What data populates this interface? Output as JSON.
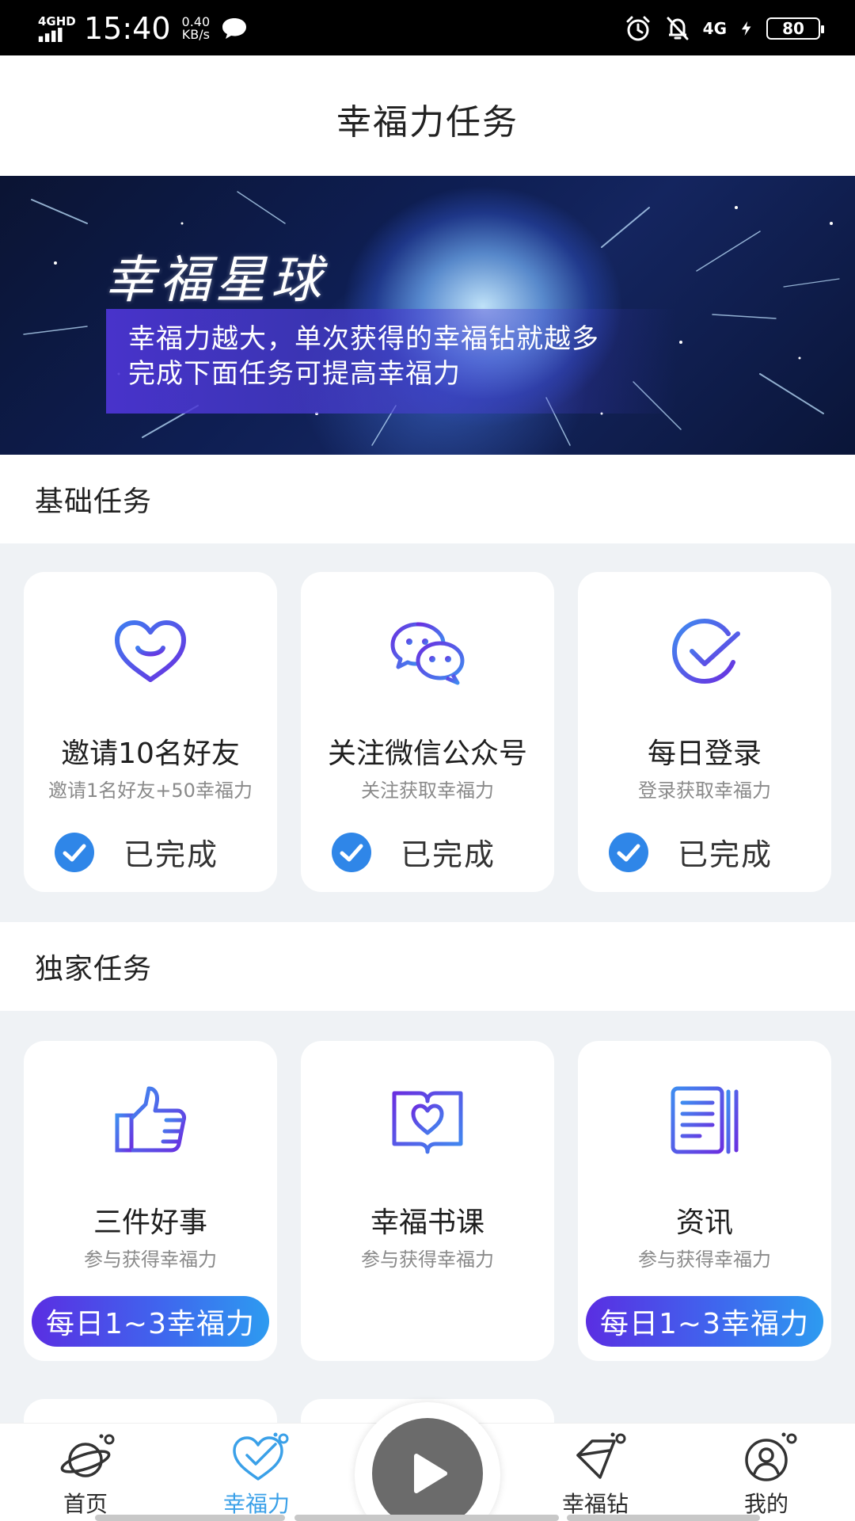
{
  "status_bar": {
    "network_label": "4GHD",
    "time": "15:40",
    "speed_value": "0.40",
    "speed_unit": "KB/s",
    "net_4g": "4G",
    "battery": "80"
  },
  "header": {
    "title": "幸福力任务"
  },
  "banner": {
    "title": "幸福星球",
    "line1": "幸福力越大，单次获得的幸福钻就越多",
    "line2": "完成下面任务可提高幸福力"
  },
  "basic": {
    "title": "基础任务",
    "cards": [
      {
        "icon": "heart-smile-icon",
        "title": "邀请10名好友",
        "subtitle": "邀请1名好友+50幸福力",
        "status": "已完成"
      },
      {
        "icon": "wechat-icon",
        "title": "关注微信公众号",
        "subtitle": "关注获取幸福力",
        "status": "已完成"
      },
      {
        "icon": "check-circle-icon",
        "title": "每日登录",
        "subtitle": "登录获取幸福力",
        "status": "已完成"
      }
    ]
  },
  "exclusive": {
    "title": "独家任务",
    "cards": [
      {
        "icon": "thumbs-up-icon",
        "title": "三件好事",
        "subtitle": "参与获得幸福力",
        "badge": "每日1~3幸福力"
      },
      {
        "icon": "heart-book-icon",
        "title": "幸福书课",
        "subtitle": "参与获得幸福力",
        "badge": ""
      },
      {
        "icon": "news-icon",
        "title": "资讯",
        "subtitle": "参与获得幸福力",
        "badge": "每日1~3幸福力"
      }
    ]
  },
  "nav": {
    "items": [
      {
        "label": "首页",
        "icon": "planet-icon",
        "active": false
      },
      {
        "label": "幸福力",
        "icon": "heart-check-icon",
        "active": true
      },
      {
        "label": "",
        "icon": "play-icon",
        "active": false
      },
      {
        "label": "幸福钻",
        "icon": "diamond-icon",
        "active": false
      },
      {
        "label": "我的",
        "icon": "user-icon",
        "active": false
      }
    ]
  },
  "colors": {
    "accent": "#3aa0e8",
    "check_blue": "#2f86e8",
    "gradient_start": "#5a2ee2",
    "gradient_end": "#2d9bf0",
    "background_gray": "#eff2f5"
  }
}
